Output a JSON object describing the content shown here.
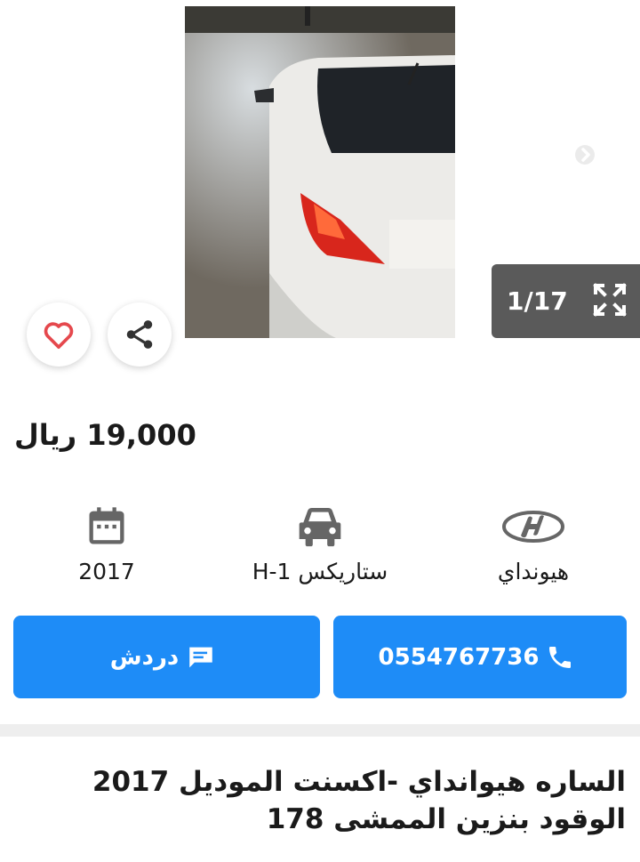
{
  "gallery": {
    "counter": "1/17",
    "photo_alt": "car-photo"
  },
  "listing": {
    "price": "19,000 ريال",
    "year": "2017",
    "model": "H-1 ستاريكس",
    "make": "هيونداي",
    "title": "الساره هيوانداي -اكسنت الموديل 2017 الوقود بنزين الممشى 178"
  },
  "actions": {
    "chat_label": "دردش",
    "phone_label": "0554767736"
  },
  "colors": {
    "accent": "#1e8cf7",
    "heart": "#e5484d",
    "counter_bg": "#5a5a5a"
  },
  "icons": {
    "favorite": "heart-icon",
    "share": "share-icon",
    "expand": "expand-icon",
    "calendar": "calendar-icon",
    "car": "car-icon",
    "brand": "hyundai-logo-icon",
    "chat": "chat-icon",
    "phone": "phone-icon"
  }
}
